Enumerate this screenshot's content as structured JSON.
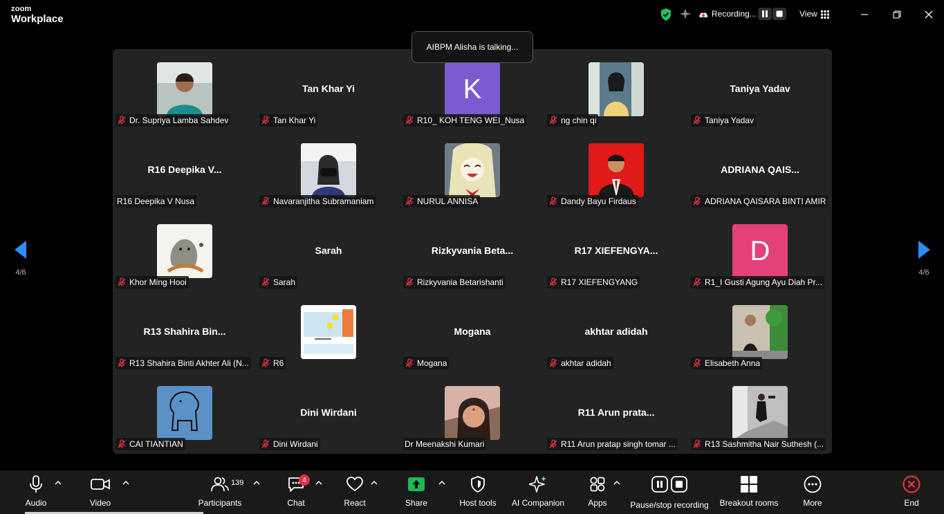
{
  "app": {
    "logo_line1": "zoom",
    "logo_line2": "Workplace"
  },
  "topbar": {
    "recording_label": "Recording...",
    "view_label": "View"
  },
  "talking": "AIBPM Alisha is talking...",
  "nav": {
    "page": "4/6"
  },
  "tiles": [
    {
      "label": "Dr. Supriya Lamba Sahdev",
      "muted": true,
      "display": "photo"
    },
    {
      "label": "Tan Khar Yi",
      "muted": true,
      "display": "name",
      "name_display": "Tan Khar Yi"
    },
    {
      "label": "R10_ KOH TENG WEI_Nusa",
      "muted": true,
      "display": "letter",
      "letter": "K",
      "color": "#7b5bd0"
    },
    {
      "label": "ng chin qi",
      "muted": true,
      "display": "photo"
    },
    {
      "label": "Taniya Yadav",
      "muted": true,
      "display": "name",
      "name_display": "Taniya Yadav"
    },
    {
      "label": "R16 Deepika V Nusa",
      "muted": false,
      "display": "name",
      "name_display": "R16  Deepika  V..."
    },
    {
      "label": "Navaranjitha Subramaniam",
      "muted": true,
      "display": "photo"
    },
    {
      "label": "NURUL ANNISA",
      "muted": true,
      "display": "photo"
    },
    {
      "label": "Dandy Bayu Firdaus",
      "muted": true,
      "display": "photo"
    },
    {
      "label": "ADRIANA QAISARA BINTI AMIR",
      "muted": true,
      "display": "name",
      "name_display": "ADRIANA  QAIS..."
    },
    {
      "label": "Khor Ming Hooi",
      "muted": true,
      "display": "photo"
    },
    {
      "label": "Sarah",
      "muted": true,
      "display": "name",
      "name_display": "Sarah"
    },
    {
      "label": "Rizkyvania Betarishanti",
      "muted": true,
      "display": "name",
      "name_display": "Rizkyvania  Beta..."
    },
    {
      "label": "R17 XIEFENGYANG",
      "muted": true,
      "display": "name",
      "name_display": "R17  XIEFENGYA..."
    },
    {
      "label": "R1_I Gusti Agung Ayu Diah Pr...",
      "muted": true,
      "display": "letter",
      "letter": "D",
      "color": "#e2417a"
    },
    {
      "label": "R13 Shahira Binti Akhter Ali (N...",
      "muted": true,
      "display": "name",
      "name_display": "R13  Shahira  Bin..."
    },
    {
      "label": "R6",
      "muted": true,
      "display": "photo"
    },
    {
      "label": "Mogana",
      "muted": true,
      "display": "name",
      "name_display": "Mogana"
    },
    {
      "label": "akhtar adidah",
      "muted": true,
      "display": "name",
      "name_display": "akhtar adidah"
    },
    {
      "label": "Elisabeth Anna",
      "muted": true,
      "display": "photo"
    },
    {
      "label": "CAI TIANTIAN",
      "muted": true,
      "display": "photo"
    },
    {
      "label": "Dini Wirdani",
      "muted": true,
      "display": "name",
      "name_display": "Dini Wirdani"
    },
    {
      "label": "Dr Meenakshi Kumari",
      "muted": false,
      "display": "photo"
    },
    {
      "label": "R11 Arun pratap singh tomar ...",
      "muted": true,
      "display": "name",
      "name_display": "R11  Arun  prata..."
    },
    {
      "label": "R13 Sashmitha Nair Suthesh (...",
      "muted": true,
      "display": "photo"
    }
  ],
  "toolbar": {
    "audio": "Audio",
    "video": "Video",
    "participants": "Participants",
    "participants_count": "139",
    "chat": "Chat",
    "chat_badge": "4",
    "react": "React",
    "share": "Share",
    "host_tools": "Host tools",
    "ai_companion": "AI Companion",
    "apps": "Apps",
    "pause_recording": "Pause/stop recording",
    "breakout": "Breakout rooms",
    "more": "More",
    "end": "End"
  },
  "colors": {
    "share_green": "#1db954",
    "end_red": "#e5323f",
    "shield_green": "#23c05b",
    "rec_red": "#e5323f"
  }
}
